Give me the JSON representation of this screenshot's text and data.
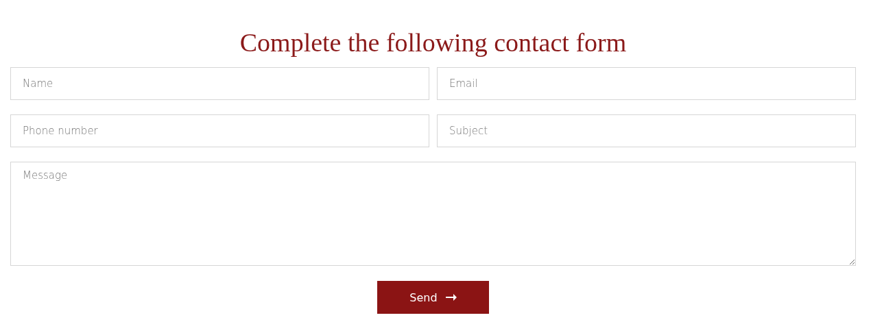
{
  "title": "Complete the following contact form",
  "fields": [
    {
      "placeholder": "Name"
    },
    {
      "placeholder": "Email"
    },
    {
      "placeholder": "Phone number"
    },
    {
      "placeholder": "Subject"
    }
  ],
  "message": {
    "placeholder": "Message"
  },
  "button": {
    "label": "Send"
  }
}
